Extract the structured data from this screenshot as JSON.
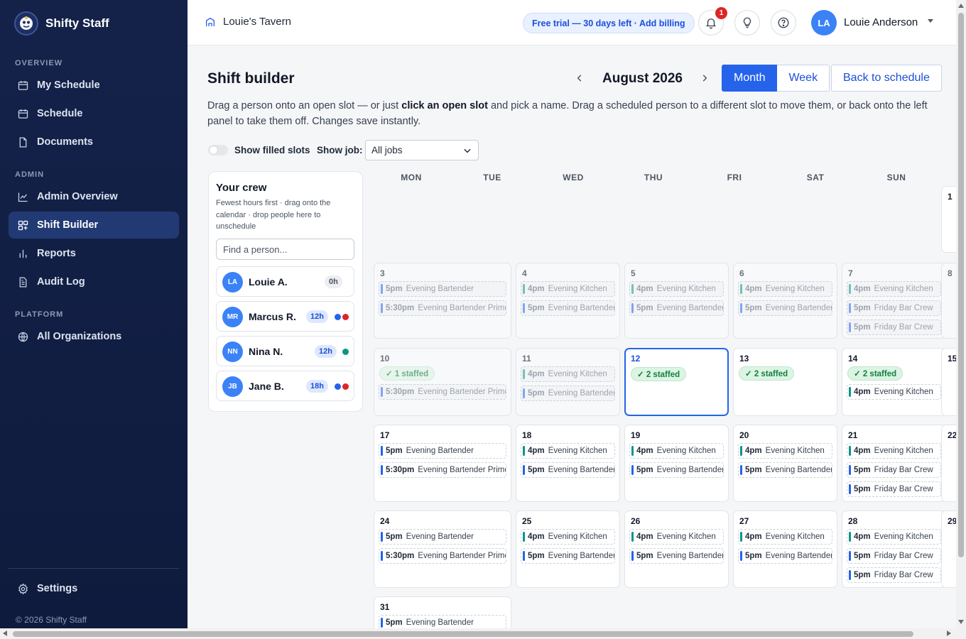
{
  "app": {
    "name": "Shifty Staff",
    "copyright": "© 2026 Shifty Staff"
  },
  "sidebar": {
    "sections": [
      "OVERVIEW",
      "ADMIN",
      "PLATFORM"
    ],
    "items": [
      {
        "label": "My Schedule",
        "icon": "calendar-icon"
      },
      {
        "label": "Schedule",
        "icon": "calendar-icon"
      },
      {
        "label": "Documents",
        "icon": "document-icon"
      },
      {
        "label": "Admin Overview",
        "icon": "line-chart-icon"
      },
      {
        "label": "Shift Builder",
        "icon": "grid-plus-icon",
        "active": true
      },
      {
        "label": "Reports",
        "icon": "bar-chart-icon"
      },
      {
        "label": "Audit Log",
        "icon": "clipboard-icon"
      },
      {
        "label": "All Organizations",
        "icon": "globe-icon"
      }
    ],
    "settings": {
      "label": "Settings",
      "icon": "gear-icon"
    }
  },
  "topbar": {
    "org_name": "Louie's Tavern",
    "trial_text": "Free trial — 30 days left · Add billing",
    "notification_count": "1",
    "user_initials": "LA",
    "user_name": "Louie Anderson"
  },
  "builder": {
    "title": "Shift builder",
    "month_label": "August 2026",
    "view_month": "Month",
    "view_week": "Week",
    "back_label": "Back to schedule",
    "instr_1": "Drag a person onto an open slot — or just ",
    "instr_bold": "click an open slot",
    "instr_2": " and pick a name. Drag a scheduled person to a different slot to move them, or back onto the left panel to take them off. Changes save instantly.",
    "show_filled_label": "Show filled slots",
    "show_job_label": "Show job:",
    "job_selected": "All jobs"
  },
  "crew": {
    "title": "Your crew",
    "subtitle": "Fewest hours first · drag onto the calendar · drop people here to unschedule",
    "search_placeholder": "Find a person...",
    "members": [
      {
        "initials": "LA",
        "name": "Louie A.",
        "hours": "0h",
        "dots": []
      },
      {
        "initials": "MR",
        "name": "Marcus R.",
        "hours": "12h",
        "dots": [
          "#2563eb",
          "#dc2626"
        ]
      },
      {
        "initials": "NN",
        "name": "Nina N.",
        "hours": "12h",
        "dots": [
          "#0d9488"
        ]
      },
      {
        "initials": "JB",
        "name": "Jane B.",
        "hours": "18h",
        "dots": [
          "#2563eb",
          "#dc2626"
        ]
      }
    ]
  },
  "calendar": {
    "weekdays": [
      "MON",
      "TUE",
      "WED",
      "THU",
      "FRI",
      "SAT",
      "SUN"
    ],
    "colors": {
      "bartender": "#2563eb",
      "kitchen": "#0d9488",
      "staffed_bg": "#dcf4e4",
      "accent": "#2563eb"
    },
    "weeks": [
      [
        null,
        null,
        null,
        null,
        null,
        null,
        {
          "num": "1",
          "slots": []
        }
      ],
      [
        {
          "num": "3",
          "past": true,
          "slots": [
            {
              "time": "5pm",
              "name": "Evening Bartender",
              "c": "bartender"
            },
            {
              "time": "5:30pm",
              "name": "Evening Bartender Prime",
              "c": "bartender"
            }
          ]
        },
        {
          "num": "4",
          "past": true,
          "slots": [
            {
              "time": "4pm",
              "name": "Evening Kitchen",
              "c": "kitchen"
            },
            {
              "time": "5pm",
              "name": "Evening Bartender",
              "c": "bartender"
            }
          ]
        },
        {
          "num": "5",
          "past": true,
          "slots": [
            {
              "time": "4pm",
              "name": "Evening Kitchen",
              "c": "kitchen"
            },
            {
              "time": "5pm",
              "name": "Evening Bartender",
              "c": "bartender"
            }
          ]
        },
        {
          "num": "6",
          "past": true,
          "slots": [
            {
              "time": "4pm",
              "name": "Evening Kitchen",
              "c": "kitchen"
            },
            {
              "time": "5pm",
              "name": "Evening Bartender",
              "c": "bartender"
            }
          ]
        },
        {
          "num": "7",
          "past": true,
          "slots": [
            {
              "time": "4pm",
              "name": "Evening Kitchen",
              "c": "kitchen"
            },
            {
              "time": "5pm",
              "name": "Friday Bar Crew",
              "c": "bartender"
            },
            {
              "time": "5pm",
              "name": "Friday Bar Crew",
              "c": "bartender"
            }
          ]
        },
        {
          "num": "8",
          "past": true,
          "slots": []
        }
      ],
      [
        {
          "num": "10",
          "past": true,
          "staffed": "✓ 1 staffed",
          "slots": [
            {
              "time": "5:30pm",
              "name": "Evening Bartender Prime",
              "c": "bartender"
            }
          ]
        },
        {
          "num": "11",
          "past": true,
          "slots": [
            {
              "time": "4pm",
              "name": "Evening Kitchen",
              "c": "kitchen"
            },
            {
              "time": "5pm",
              "name": "Evening Bartender",
              "c": "bartender"
            }
          ]
        },
        {
          "num": "12",
          "today": true,
          "staffed": "✓ 2 staffed",
          "slots": []
        },
        {
          "num": "13",
          "staffed": "✓ 2 staffed",
          "slots": []
        },
        {
          "num": "14",
          "staffed": "✓ 2 staffed",
          "slots": [
            {
              "time": "4pm",
              "name": "Evening Kitchen",
              "c": "kitchen"
            }
          ]
        },
        {
          "num": "15",
          "slots": []
        }
      ],
      [
        {
          "num": "17",
          "slots": [
            {
              "time": "5pm",
              "name": "Evening Bartender",
              "c": "bartender"
            },
            {
              "time": "5:30pm",
              "name": "Evening Bartender Prime",
              "c": "bartender"
            }
          ]
        },
        {
          "num": "18",
          "slots": [
            {
              "time": "4pm",
              "name": "Evening Kitchen",
              "c": "kitchen"
            },
            {
              "time": "5pm",
              "name": "Evening Bartender",
              "c": "bartender"
            }
          ]
        },
        {
          "num": "19",
          "slots": [
            {
              "time": "4pm",
              "name": "Evening Kitchen",
              "c": "kitchen"
            },
            {
              "time": "5pm",
              "name": "Evening Bartender",
              "c": "bartender"
            }
          ]
        },
        {
          "num": "20",
          "slots": [
            {
              "time": "4pm",
              "name": "Evening Kitchen",
              "c": "kitchen"
            },
            {
              "time": "5pm",
              "name": "Evening Bartender",
              "c": "bartender"
            }
          ]
        },
        {
          "num": "21",
          "slots": [
            {
              "time": "4pm",
              "name": "Evening Kitchen",
              "c": "kitchen"
            },
            {
              "time": "5pm",
              "name": "Friday Bar Crew",
              "c": "bartender"
            },
            {
              "time": "5pm",
              "name": "Friday Bar Crew",
              "c": "bartender"
            }
          ]
        },
        {
          "num": "22",
          "slots": []
        }
      ],
      [
        {
          "num": "24",
          "slots": [
            {
              "time": "5pm",
              "name": "Evening Bartender",
              "c": "bartender"
            },
            {
              "time": "5:30pm",
              "name": "Evening Bartender Prime",
              "c": "bartender"
            }
          ]
        },
        {
          "num": "25",
          "slots": [
            {
              "time": "4pm",
              "name": "Evening Kitchen",
              "c": "kitchen"
            },
            {
              "time": "5pm",
              "name": "Evening Bartender",
              "c": "bartender"
            }
          ]
        },
        {
          "num": "26",
          "slots": [
            {
              "time": "4pm",
              "name": "Evening Kitchen",
              "c": "kitchen"
            },
            {
              "time": "5pm",
              "name": "Evening Bartender",
              "c": "bartender"
            }
          ]
        },
        {
          "num": "27",
          "slots": [
            {
              "time": "4pm",
              "name": "Evening Kitchen",
              "c": "kitchen"
            },
            {
              "time": "5pm",
              "name": "Evening Bartender",
              "c": "bartender"
            }
          ]
        },
        {
          "num": "28",
          "slots": [
            {
              "time": "4pm",
              "name": "Evening Kitchen",
              "c": "kitchen"
            },
            {
              "time": "5pm",
              "name": "Friday Bar Crew",
              "c": "bartender"
            },
            {
              "time": "5pm",
              "name": "Friday Bar Crew",
              "c": "bartender"
            }
          ]
        },
        {
          "num": "29",
          "slots": []
        }
      ],
      [
        {
          "num": "31",
          "slots": [
            {
              "time": "5pm",
              "name": "Evening Bartender",
              "c": "bartender"
            }
          ]
        }
      ]
    ]
  }
}
